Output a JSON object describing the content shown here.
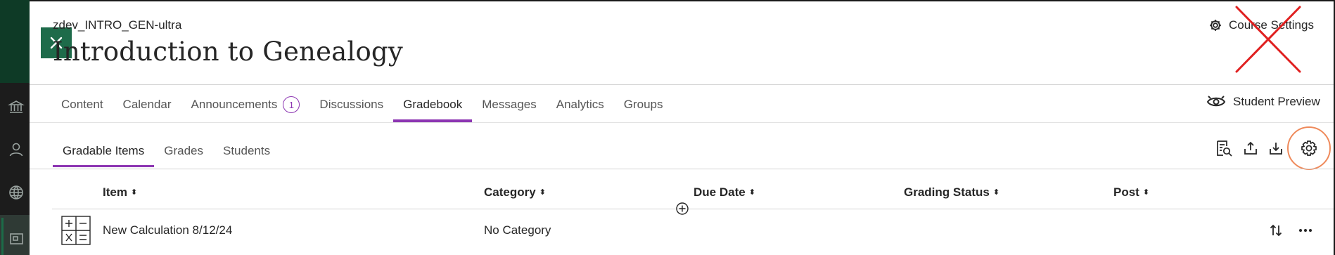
{
  "course": {
    "id": "zdev_INTRO_GEN-ultra",
    "title": "Introduction to Genealogy",
    "settings_label": "Course Settings",
    "student_preview_label": "Student Preview"
  },
  "nav": {
    "tabs": [
      {
        "label": "Content"
      },
      {
        "label": "Calendar"
      },
      {
        "label": "Announcements",
        "badge": "1"
      },
      {
        "label": "Discussions"
      },
      {
        "label": "Gradebook",
        "active": true
      },
      {
        "label": "Messages"
      },
      {
        "label": "Analytics"
      },
      {
        "label": "Groups"
      }
    ]
  },
  "gradebook": {
    "tabs": [
      {
        "label": "Gradable Items",
        "active": true
      },
      {
        "label": "Grades"
      },
      {
        "label": "Students"
      }
    ],
    "columns": {
      "item": "Item",
      "category": "Category",
      "due_date": "Due Date",
      "grading_status": "Grading Status",
      "post": "Post"
    },
    "rows": [
      {
        "item": "New Calculation 8/12/24",
        "category": "No Category",
        "due_date": "",
        "grading_status": "",
        "post": ""
      }
    ]
  },
  "icons": {
    "close": "close-icon",
    "gear": "gear-icon",
    "preview": "eye-preview-icon",
    "search_doc": "document-search-icon",
    "upload": "upload-icon",
    "download": "download-icon",
    "calculation": "calculation-icon",
    "reorder": "reorder-arrows-icon",
    "more": "more-horizontal-icon",
    "add": "add-circle-icon"
  },
  "colors": {
    "accent_purple": "#8c35b2",
    "brand_green": "#1e6b4a",
    "annotation_red": "#e02020",
    "annotation_orange": "#ef8a5b"
  }
}
